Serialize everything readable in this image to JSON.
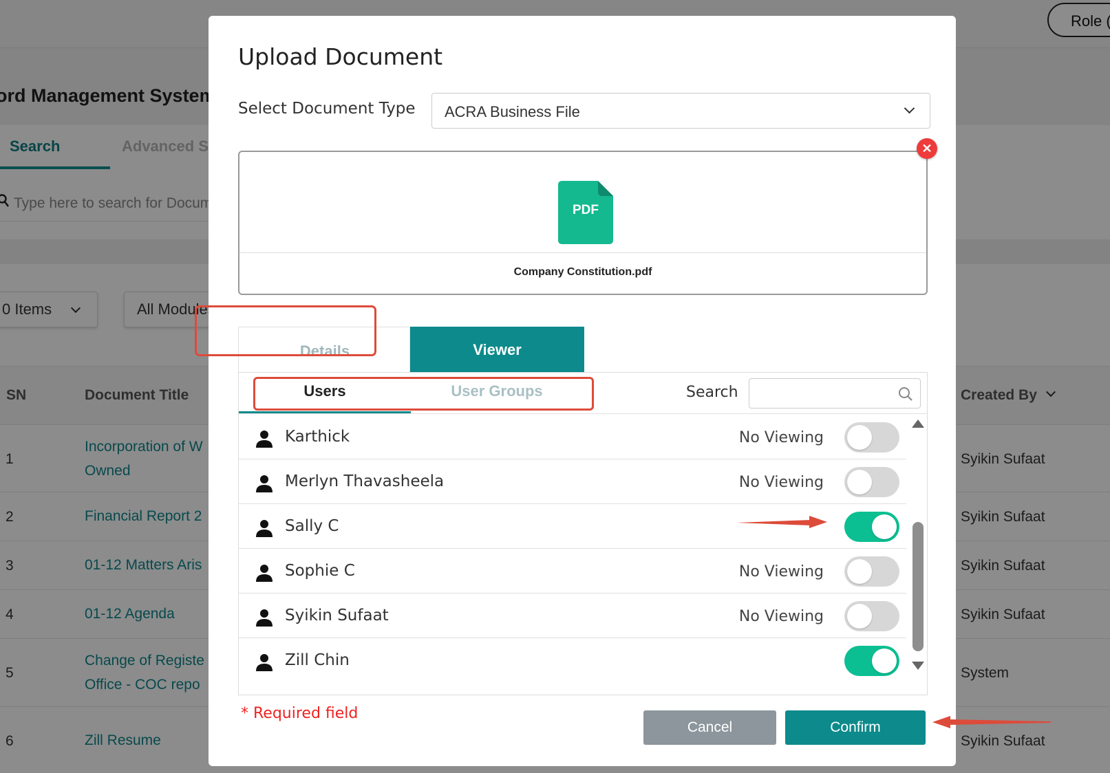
{
  "background": {
    "role_button": "Role (",
    "page_title": "ord Management System",
    "tabs": [
      "Search",
      "Advanced Se"
    ],
    "search_placeholder": "Type here to search for Docum",
    "items_select": "0 Items",
    "modules_select": "All Modules",
    "table": {
      "headers": {
        "sn": "SN",
        "title": "Document Title",
        "created_by": "Created By"
      },
      "rows": [
        {
          "sn": "1",
          "title": [
            "Incorporation of W",
            "Owned"
          ],
          "created_by": "Syikin Sufaat"
        },
        {
          "sn": "2",
          "title": [
            "Financial Report 2"
          ],
          "created_by": "Syikin Sufaat"
        },
        {
          "sn": "3",
          "title": [
            "01-12 Matters Aris"
          ],
          "created_by": "Syikin Sufaat"
        },
        {
          "sn": "4",
          "title": [
            "01-12 Agenda"
          ],
          "created_by": "Syikin Sufaat"
        },
        {
          "sn": "5",
          "title": [
            "Change of Registe",
            "Office - COC repo"
          ],
          "created_by": "System"
        },
        {
          "sn": "6",
          "title": [
            "Zill Resume"
          ],
          "created_by": "Syikin Sufaat"
        }
      ]
    }
  },
  "modal": {
    "title": "Upload Document",
    "doc_type_label": "Select Document Type",
    "doc_type_value": "ACRA Business File",
    "file": {
      "icon_label": "PDF",
      "name": "Company Constitution.pdf"
    },
    "tabs": {
      "details": "Details",
      "viewer": "Viewer"
    },
    "sub_tabs": {
      "users": "Users",
      "groups": "User Groups"
    },
    "search_label": "Search",
    "users": [
      {
        "name": "Karthick",
        "status": "No Viewing",
        "enabled": false
      },
      {
        "name": "Merlyn Thavasheela",
        "status": "No Viewing",
        "enabled": false
      },
      {
        "name": "Sally C",
        "status": "",
        "enabled": true
      },
      {
        "name": "Sophie C",
        "status": "No Viewing",
        "enabled": false
      },
      {
        "name": "Syikin Sufaat",
        "status": "No Viewing",
        "enabled": false
      },
      {
        "name": "Zill Chin",
        "status": "",
        "enabled": true
      }
    ],
    "required_note": "* Required field",
    "cancel_label": "Cancel",
    "confirm_label": "Confirm"
  },
  "colors": {
    "accent": "#0d8a8b",
    "toggle_on": "#0bbf92",
    "annotation": "#dd4b3a",
    "required": "#ee2222"
  }
}
